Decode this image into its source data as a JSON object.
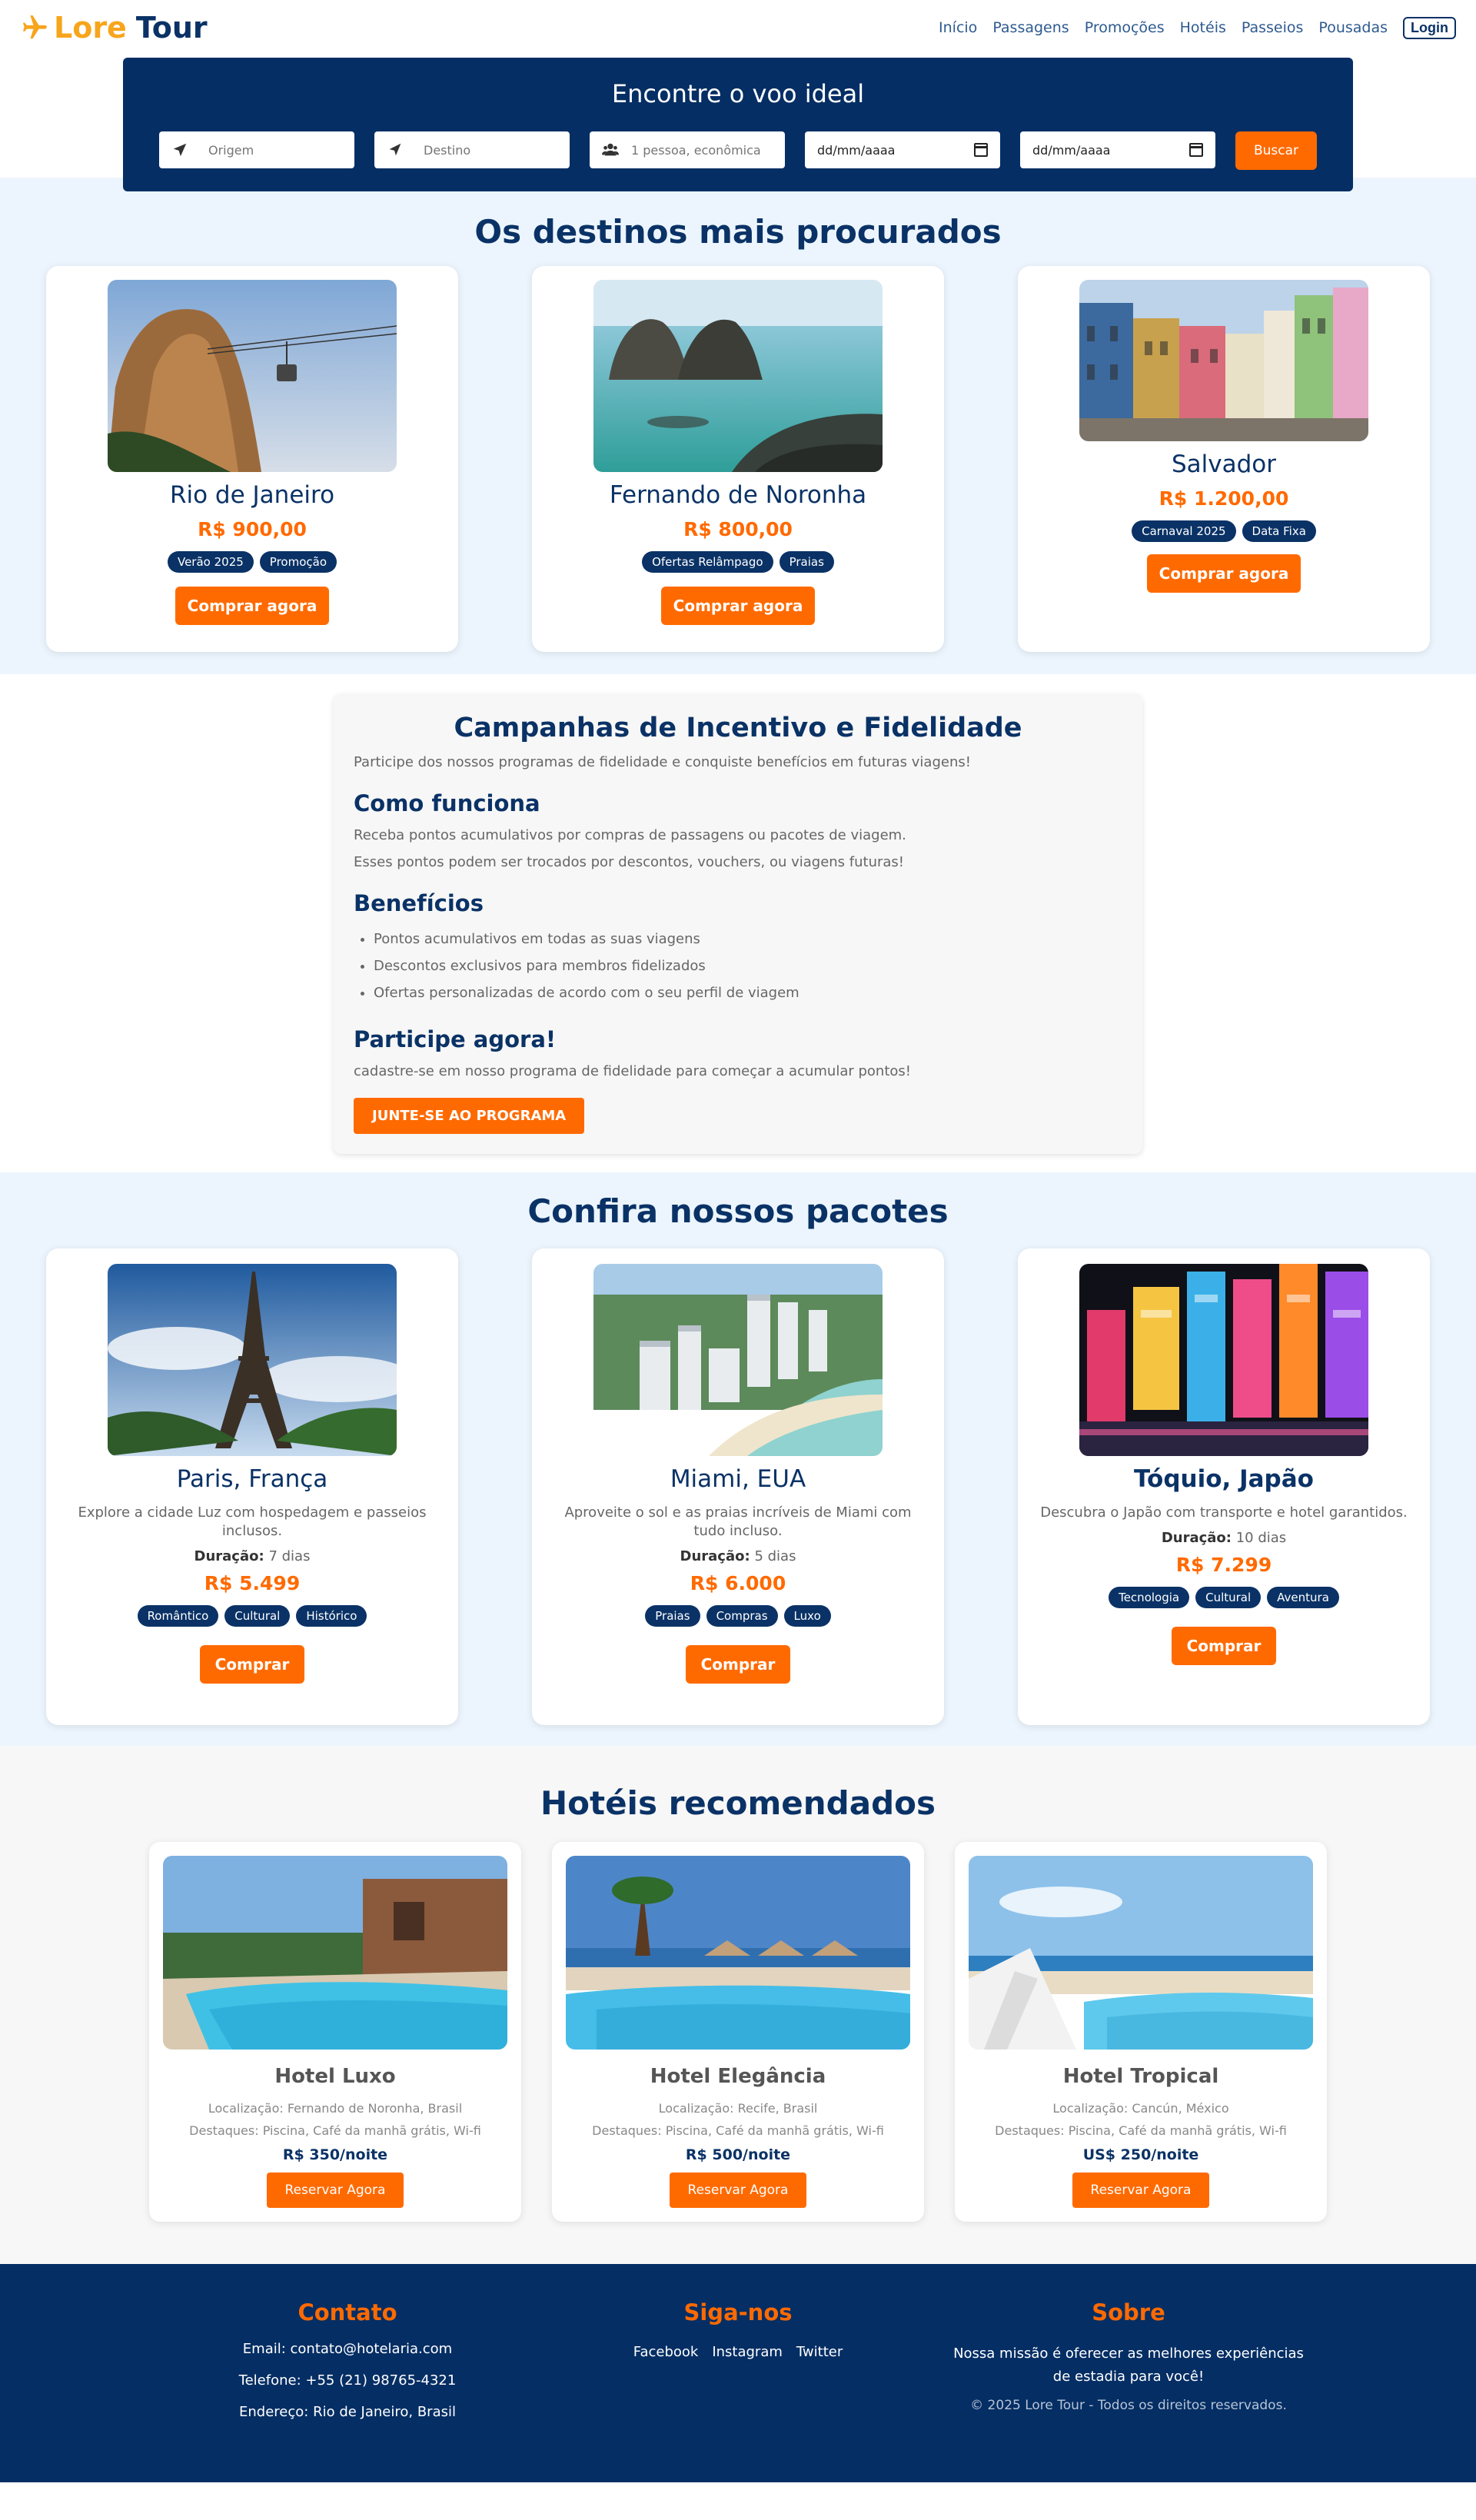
{
  "brand": {
    "word1": "Lore",
    "word2": "Tour"
  },
  "nav": {
    "links": [
      "Início",
      "Passagens",
      "Promoções",
      "Hotéis",
      "Passeios",
      "Pousadas"
    ],
    "login": "Login"
  },
  "search": {
    "title": "Encontre o voo ideal",
    "origin_placeholder": "Origem",
    "dest_placeholder": "Destino",
    "pax_placeholder": "1 pessoa, econômica",
    "date1": "dd/mm/aaaa",
    "date2": "dd/mm/aaaa",
    "button": "Buscar"
  },
  "destinations": {
    "title": "Os destinos mais procurados",
    "items": [
      {
        "name": "Rio de Janeiro",
        "price": "R$ 900,00",
        "tags": [
          "Verão 2025",
          "Promoção"
        ],
        "button": "Comprar agora"
      },
      {
        "name": "Fernando de Noronha",
        "price": "R$ 800,00",
        "tags": [
          "Ofertas Relâmpago",
          "Praias"
        ],
        "button": "Comprar agora"
      },
      {
        "name": "Salvador",
        "price": "R$ 1.200,00",
        "tags": [
          "Carnaval 2025",
          "Data Fixa"
        ],
        "button": "Comprar agora"
      }
    ]
  },
  "loyalty": {
    "title": "Campanhas de Incentivo e Fidelidade",
    "intro": "Participe dos nossos programas de fidelidade e conquiste benefícios em futuras viagens!",
    "how_title": "Como funciona",
    "how_p1": "Receba pontos acumulativos por compras de passagens ou pacotes de viagem.",
    "how_p2": "Esses pontos podem ser trocados por descontos, vouchers, ou viagens futuras!",
    "benefits_title": "Benefícios",
    "benefits": [
      "Pontos acumulativos em todas as suas viagens",
      "Descontos exclusivos para membros fidelizados",
      "Ofertas personalizadas de acordo com o seu perfil de viagem"
    ],
    "join_title": "Participe agora!",
    "join_text": "cadastre-se em nosso programa de fidelidade para começar a acumular pontos!",
    "join_button": "JUNTE-SE AO PROGRAMA"
  },
  "packages": {
    "title": "Confira nossos pacotes",
    "duration_label": "Duração:",
    "items": [
      {
        "name": "Paris, França",
        "desc": "Explore a cidade Luz com hospedagem e passeios inclusos.",
        "duration": "7 dias",
        "price": "R$ 5.499",
        "tags": [
          "Romântico",
          "Cultural",
          "Histórico"
        ],
        "button": "Comprar"
      },
      {
        "name": "Miami, EUA",
        "desc": "Aproveite o sol e as praias incríveis de Miami com tudo incluso.",
        "duration": "5 dias",
        "price": "R$ 6.000",
        "tags": [
          "Praias",
          "Compras",
          "Luxo"
        ],
        "button": "Comprar"
      },
      {
        "name": "Tóquio, Japão",
        "desc": "Descubra o Japão com transporte e hotel garantidos.",
        "duration": "10 dias",
        "price": "R$ 7.299",
        "tags": [
          "Tecnologia",
          "Cultural",
          "Aventura"
        ],
        "button": "Comprar"
      }
    ]
  },
  "hotels": {
    "title": "Hotéis recomendados",
    "items": [
      {
        "name": "Hotel Luxo",
        "location": "Localização: Fernando de Noronha, Brasil",
        "highlights": "Destaques: Piscina, Café da manhã grátis, Wi-fi",
        "price": "R$ 350/noite",
        "button": "Reservar Agora"
      },
      {
        "name": "Hotel Elegância",
        "location": "Localização: Recife, Brasil",
        "highlights": "Destaques: Piscina, Café da manhã grátis, Wi-fi",
        "price": "R$ 500/noite",
        "button": "Reservar Agora"
      },
      {
        "name": "Hotel Tropical",
        "location": "Localização: Cancún, México",
        "highlights": "Destaques: Piscina, Café da manhã grátis, Wi-fi",
        "price": "US$ 250/noite",
        "button": "Reservar Agora"
      }
    ]
  },
  "footer": {
    "contact_title": "Contato",
    "email": "Email: contato@hotelaria.com",
    "phone": "Telefone: +55 (21) 98765-4321",
    "address": "Endereço: Rio de Janeiro, Brasil",
    "social_title": "Siga-nos",
    "social": [
      "Facebook",
      "Instagram",
      "Twitter"
    ],
    "about_title": "Sobre",
    "about": "Nossa missão é oferecer as melhores experiências de estadia para você!",
    "copyright": "© 2025 Lore Tour - Todos os direitos reservados."
  },
  "colors": {
    "navy": "#052e64",
    "orange": "#ff6a00",
    "brand_yellow": "#f7a51c",
    "light_blue_bg": "#ecf5fd"
  },
  "icons": [
    "airplane-icon",
    "location-arrow-icon",
    "navigation-arrow-icon",
    "users-icon",
    "calendar-icon"
  ]
}
